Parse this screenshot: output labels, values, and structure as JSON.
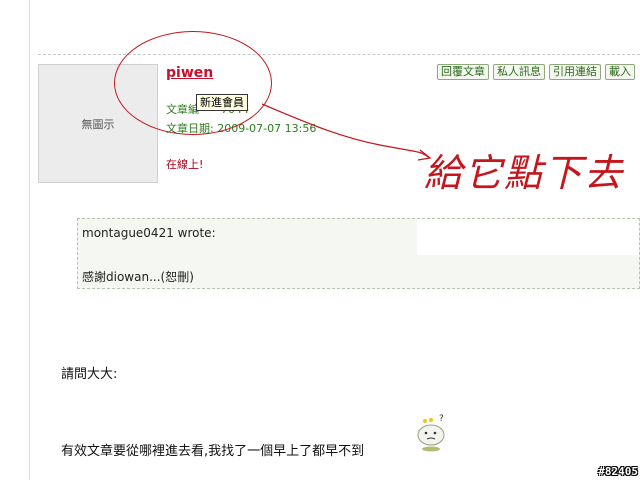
{
  "post": {
    "avatar_placeholder": "無圖示",
    "username": "piwen",
    "posts_label": "文章編",
    "posts_count_partial": "7044",
    "date_label": "文章日期:",
    "date_value": "2009-07-07 13:56",
    "online_status": "在線上!",
    "tooltip_rank": "新進會員"
  },
  "actions": {
    "reply_quote": "回覆文章",
    "private_message": "私人訊息",
    "quote_link": "引用連結",
    "add_partial": "載入"
  },
  "quote": {
    "author": "montague0421 wrote:",
    "text": "感謝diowan...(恕刪)"
  },
  "message": {
    "line1": "請問大大:",
    "line2": "有效文章要從哪裡進去看,我找了一個早上了都早不到"
  },
  "annotation": {
    "text": "給它點下去",
    "color": "#c4161c"
  },
  "watermark": "#82405",
  "colors": {
    "username": "#c8102e",
    "meta_green": "#2e7d1e",
    "annotation_red": "#c4161c"
  }
}
